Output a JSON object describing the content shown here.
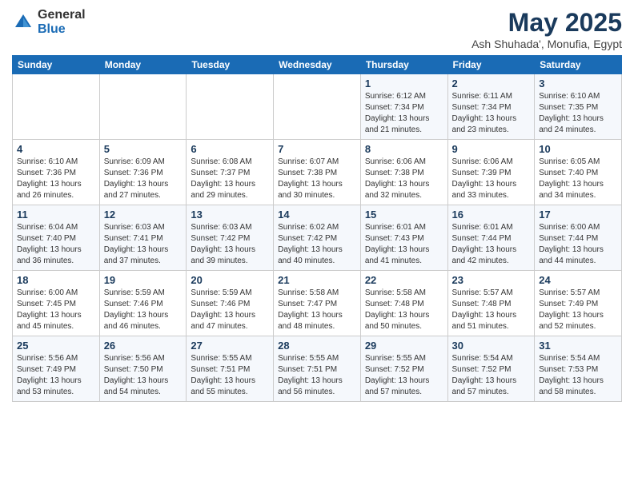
{
  "header": {
    "logo_general": "General",
    "logo_blue": "Blue",
    "title": "May 2025",
    "subtitle": "Ash Shuhada', Monufia, Egypt"
  },
  "weekdays": [
    "Sunday",
    "Monday",
    "Tuesday",
    "Wednesday",
    "Thursday",
    "Friday",
    "Saturday"
  ],
  "weeks": [
    [
      {
        "day": "",
        "info": ""
      },
      {
        "day": "",
        "info": ""
      },
      {
        "day": "",
        "info": ""
      },
      {
        "day": "",
        "info": ""
      },
      {
        "day": "1",
        "info": "Sunrise: 6:12 AM\nSunset: 7:34 PM\nDaylight: 13 hours\nand 21 minutes."
      },
      {
        "day": "2",
        "info": "Sunrise: 6:11 AM\nSunset: 7:34 PM\nDaylight: 13 hours\nand 23 minutes."
      },
      {
        "day": "3",
        "info": "Sunrise: 6:10 AM\nSunset: 7:35 PM\nDaylight: 13 hours\nand 24 minutes."
      }
    ],
    [
      {
        "day": "4",
        "info": "Sunrise: 6:10 AM\nSunset: 7:36 PM\nDaylight: 13 hours\nand 26 minutes."
      },
      {
        "day": "5",
        "info": "Sunrise: 6:09 AM\nSunset: 7:36 PM\nDaylight: 13 hours\nand 27 minutes."
      },
      {
        "day": "6",
        "info": "Sunrise: 6:08 AM\nSunset: 7:37 PM\nDaylight: 13 hours\nand 29 minutes."
      },
      {
        "day": "7",
        "info": "Sunrise: 6:07 AM\nSunset: 7:38 PM\nDaylight: 13 hours\nand 30 minutes."
      },
      {
        "day": "8",
        "info": "Sunrise: 6:06 AM\nSunset: 7:38 PM\nDaylight: 13 hours\nand 32 minutes."
      },
      {
        "day": "9",
        "info": "Sunrise: 6:06 AM\nSunset: 7:39 PM\nDaylight: 13 hours\nand 33 minutes."
      },
      {
        "day": "10",
        "info": "Sunrise: 6:05 AM\nSunset: 7:40 PM\nDaylight: 13 hours\nand 34 minutes."
      }
    ],
    [
      {
        "day": "11",
        "info": "Sunrise: 6:04 AM\nSunset: 7:40 PM\nDaylight: 13 hours\nand 36 minutes."
      },
      {
        "day": "12",
        "info": "Sunrise: 6:03 AM\nSunset: 7:41 PM\nDaylight: 13 hours\nand 37 minutes."
      },
      {
        "day": "13",
        "info": "Sunrise: 6:03 AM\nSunset: 7:42 PM\nDaylight: 13 hours\nand 39 minutes."
      },
      {
        "day": "14",
        "info": "Sunrise: 6:02 AM\nSunset: 7:42 PM\nDaylight: 13 hours\nand 40 minutes."
      },
      {
        "day": "15",
        "info": "Sunrise: 6:01 AM\nSunset: 7:43 PM\nDaylight: 13 hours\nand 41 minutes."
      },
      {
        "day": "16",
        "info": "Sunrise: 6:01 AM\nSunset: 7:44 PM\nDaylight: 13 hours\nand 42 minutes."
      },
      {
        "day": "17",
        "info": "Sunrise: 6:00 AM\nSunset: 7:44 PM\nDaylight: 13 hours\nand 44 minutes."
      }
    ],
    [
      {
        "day": "18",
        "info": "Sunrise: 6:00 AM\nSunset: 7:45 PM\nDaylight: 13 hours\nand 45 minutes."
      },
      {
        "day": "19",
        "info": "Sunrise: 5:59 AM\nSunset: 7:46 PM\nDaylight: 13 hours\nand 46 minutes."
      },
      {
        "day": "20",
        "info": "Sunrise: 5:59 AM\nSunset: 7:46 PM\nDaylight: 13 hours\nand 47 minutes."
      },
      {
        "day": "21",
        "info": "Sunrise: 5:58 AM\nSunset: 7:47 PM\nDaylight: 13 hours\nand 48 minutes."
      },
      {
        "day": "22",
        "info": "Sunrise: 5:58 AM\nSunset: 7:48 PM\nDaylight: 13 hours\nand 50 minutes."
      },
      {
        "day": "23",
        "info": "Sunrise: 5:57 AM\nSunset: 7:48 PM\nDaylight: 13 hours\nand 51 minutes."
      },
      {
        "day": "24",
        "info": "Sunrise: 5:57 AM\nSunset: 7:49 PM\nDaylight: 13 hours\nand 52 minutes."
      }
    ],
    [
      {
        "day": "25",
        "info": "Sunrise: 5:56 AM\nSunset: 7:49 PM\nDaylight: 13 hours\nand 53 minutes."
      },
      {
        "day": "26",
        "info": "Sunrise: 5:56 AM\nSunset: 7:50 PM\nDaylight: 13 hours\nand 54 minutes."
      },
      {
        "day": "27",
        "info": "Sunrise: 5:55 AM\nSunset: 7:51 PM\nDaylight: 13 hours\nand 55 minutes."
      },
      {
        "day": "28",
        "info": "Sunrise: 5:55 AM\nSunset: 7:51 PM\nDaylight: 13 hours\nand 56 minutes."
      },
      {
        "day": "29",
        "info": "Sunrise: 5:55 AM\nSunset: 7:52 PM\nDaylight: 13 hours\nand 57 minutes."
      },
      {
        "day": "30",
        "info": "Sunrise: 5:54 AM\nSunset: 7:52 PM\nDaylight: 13 hours\nand 57 minutes."
      },
      {
        "day": "31",
        "info": "Sunrise: 5:54 AM\nSunset: 7:53 PM\nDaylight: 13 hours\nand 58 minutes."
      }
    ]
  ]
}
